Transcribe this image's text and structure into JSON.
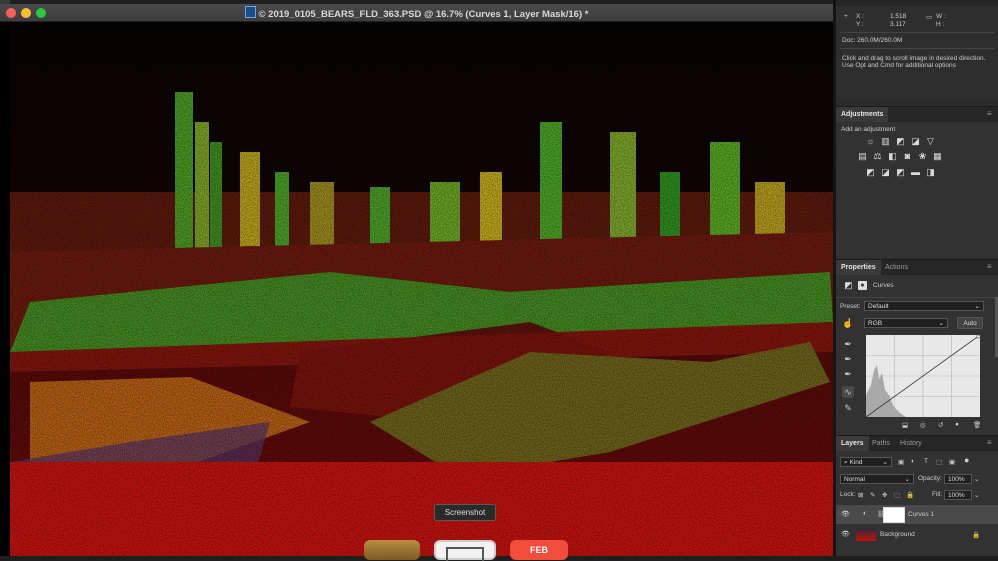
{
  "document": {
    "title": "© 2019_0105_BEARS_FLD_363.PSD @ 16.7% (Curves 1, Layer Mask/16) *"
  },
  "info": {
    "x_label": "X :",
    "x_value": "1.518",
    "y_label": "Y :",
    "y_value": "3.117",
    "w_label": "W :",
    "h_label": "H :",
    "doc_size": "Doc: 260.0M/260.0M",
    "hint_line1": "Click and drag to scroll image in desired direction.",
    "hint_line2": "Use Opt and Cmd for additional options"
  },
  "adjustments": {
    "tab": "Adjustments",
    "add_label": "Add an adjustment"
  },
  "properties": {
    "tabs": [
      "Properties",
      "Actions"
    ],
    "adjustment_name": "Curves",
    "preset_label": "Preset:",
    "preset_value": "Default",
    "channel_value": "RGB",
    "auto_label": "Auto"
  },
  "layers": {
    "tabs": [
      "Layers",
      "Paths",
      "History"
    ],
    "filter_value": "Kind",
    "blend_mode": "Normal",
    "opacity_label": "Opacity:",
    "opacity_value": "100%",
    "lock_label": "Lock:",
    "fill_label": "Fill:",
    "fill_value": "100%",
    "items": [
      {
        "name": "Curves 1"
      },
      {
        "name": "Background"
      }
    ]
  },
  "tooltip": "Screenshot",
  "dock": {
    "calendar_month": "FEB"
  },
  "colors": {
    "image_red": "#c4140f",
    "image_green": "#2ea91f",
    "image_yellow": "#d7b21a",
    "accent_blue": "#2b5cae"
  }
}
